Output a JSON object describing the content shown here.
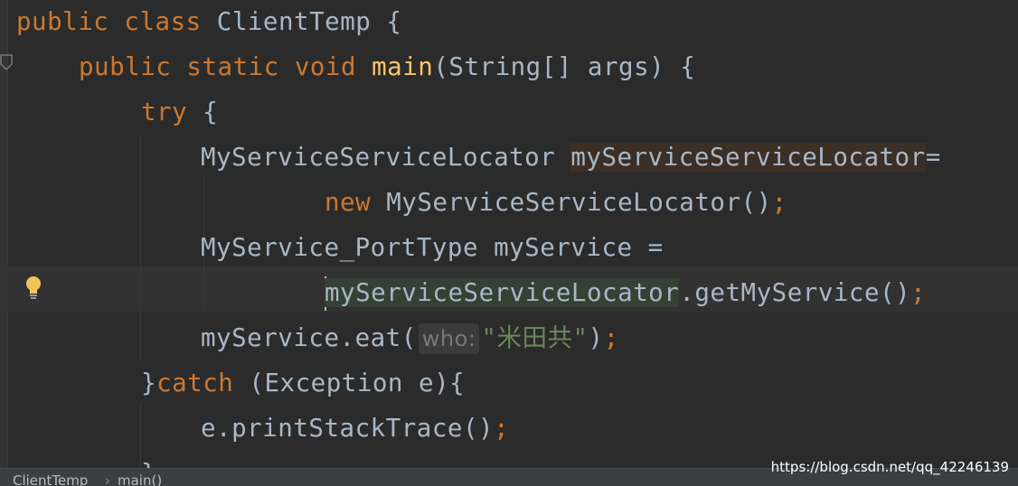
{
  "code": {
    "line1": {
      "kw_public": "public",
      "kw_class": "class",
      "class_name": "ClientTemp",
      "brace": "{"
    },
    "line2": {
      "kw_public": "public",
      "kw_static": "static",
      "kw_void": "void",
      "method": "main",
      "params": "(String[] args)",
      "brace": "{"
    },
    "line3": {
      "kw_try": "try",
      "brace": "{"
    },
    "line4": {
      "type": "MyServiceServiceLocator",
      "var": "myServiceServiceLocator",
      "op": "="
    },
    "line5": {
      "kw_new": "new",
      "ctor": "MyServiceServiceLocator()",
      "semi": ";"
    },
    "line6": {
      "text": "MyService_PortType myService ="
    },
    "line7": {
      "var": "myServiceServiceLocator",
      "call": ".getMyService()",
      "semi": ";"
    },
    "line8": {
      "call": "myService.eat(",
      "hint": "who:",
      "string": "\"米田共\"",
      "close": ")",
      "semi": ";"
    },
    "line9": {
      "brace": "}",
      "kw_catch": "catch",
      "params": "(Exception e){"
    },
    "line10": {
      "call": "e.printStackTrace()",
      "semi": ";"
    },
    "line11": {
      "brace": "}"
    }
  },
  "breadcrumb": {
    "item1": "ClientTemp",
    "sep": "›",
    "item2": "main()"
  },
  "watermark": "https://blog.csdn.net/qq_42246139",
  "colors": {
    "background": "#2b2b2b",
    "keyword": "#cc7832",
    "method": "#ffc66d",
    "string": "#6a8759",
    "text": "#a9b7c6"
  },
  "icons": {
    "gutter": "fold-marker-icon",
    "intention": "lightbulb-icon"
  }
}
